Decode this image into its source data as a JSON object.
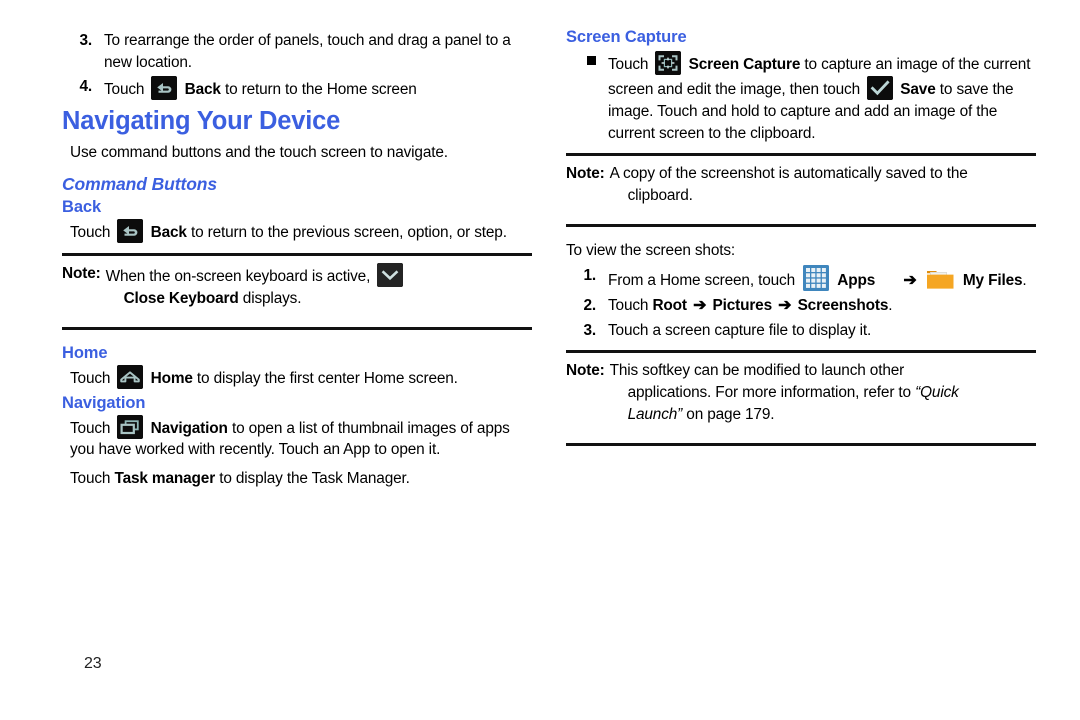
{
  "page": {
    "number": "23",
    "accent_color": "#3b5fe0",
    "icon_bg_color": "#0c0c0c",
    "icon_fg_color": "#aac6c6",
    "apps_icon_color": "#3f86bd",
    "folder_icon_color": "#f5a623"
  },
  "left_column": {
    "steps_top": [
      {
        "num": "3.",
        "text": "To rearrange the order of panels, touch and drag a panel to a new location."
      },
      {
        "num": "4.",
        "pre": "Touch",
        "icon": "back-icon",
        "bold": "Back",
        "post": "to return to the Home screen"
      }
    ],
    "heading_navigating": "Navigating Your Device",
    "intro": "Use command buttons and the touch screen to navigate.",
    "heading_command_buttons": "Command Buttons",
    "back": {
      "heading": "Back",
      "pre": "Touch",
      "icon": "back-icon",
      "bold": "Back",
      "post": "to return to the previous screen, option, or step."
    },
    "note_keyboard": {
      "label": "Note:",
      "pre": "When the on-screen keyboard is active,",
      "icon": "close-keyboard-icon",
      "bold": "Close Keyboard",
      "post": "displays."
    },
    "home": {
      "heading": "Home",
      "pre": "Touch",
      "icon": "home-icon",
      "bold": "Home",
      "post": "to display the first center Home screen."
    },
    "navigation": {
      "heading": "Navigation",
      "pre": "Touch",
      "icon": "navigation-icon",
      "bold": "Navigation",
      "post": "to open a list of thumbnail images of apps you have worked with recently. Touch an App to open it.",
      "task_pre": "Touch",
      "task_bold": "Task manager",
      "task_post": "to display the Task Manager."
    }
  },
  "right_column": {
    "heading_screen_capture": "Screen Capture",
    "capture_bullet": {
      "pre": "Touch",
      "icon": "screen-capture-icon",
      "bold": "Screen Capture",
      "mid": "to capture an image of the current screen and edit the image, then touch",
      "icon2": "save-check-icon",
      "bold2": "Save",
      "post": "to save the image. Touch and hold to capture and add an image of the current screen to the clipboard."
    },
    "note_clipboard": {
      "label": "Note:",
      "text": "A copy of the screenshot is automatically saved to the",
      "cont": "clipboard."
    },
    "view_intro": "To view the screen shots:",
    "view_steps": [
      {
        "num": "1.",
        "pre": "From a Home screen, touch",
        "icon": "apps-grid-icon",
        "bold": "Apps",
        "arrow": "➔",
        "icon2": "my-files-folder-icon",
        "bold2": "My Files",
        "post": "."
      },
      {
        "num": "2.",
        "pre": "Touch",
        "bold": "Root",
        "arrow1": "➔",
        "bold2": "Pictures",
        "arrow2": "➔",
        "bold3": "Screenshots",
        "post": "."
      },
      {
        "num": "3.",
        "text": "Touch a screen capture file to display it."
      }
    ],
    "note_softkey": {
      "label": "Note:",
      "line1": "This softkey can be modified to launch other",
      "line2_pre": "applications. For more information, refer to",
      "line2_italic": "“Quick",
      "line3_italic": "Launch”",
      "line3_post": "on page 179."
    }
  }
}
